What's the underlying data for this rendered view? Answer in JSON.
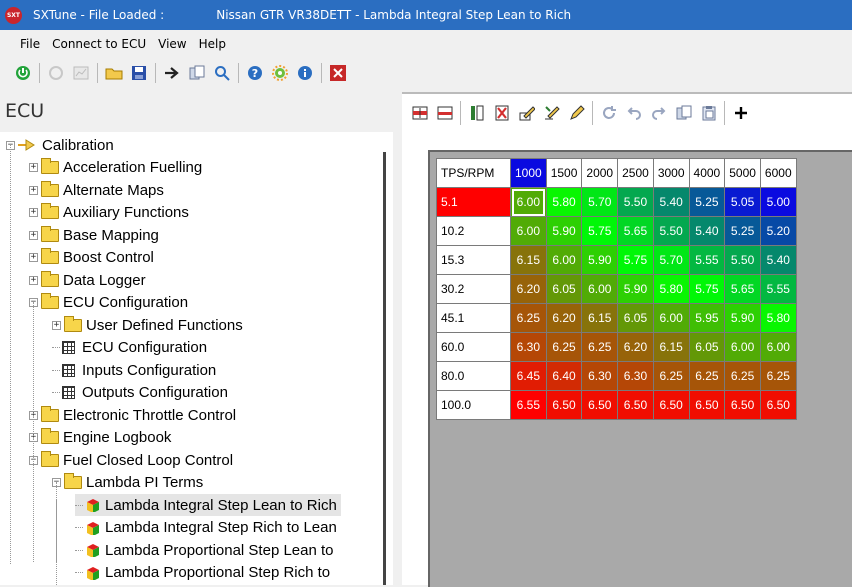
{
  "window": {
    "app_title": "SXTune - File Loaded :",
    "file_title": "Nissan GTR VR38DETT - Lambda Integral Step Lean to Rich",
    "logo_text": "SXT"
  },
  "menu": [
    "File",
    "Connect to ECU",
    "View",
    "Help"
  ],
  "toolbar_icons": [
    "power-icon",
    "disconnect-icon",
    "chart-icon",
    "open-folder-icon",
    "save-icon",
    "send-icon",
    "copy-icon",
    "search-icon",
    "help-icon",
    "settings-icon",
    "info-icon",
    "close-icon"
  ],
  "left_panel": {
    "title": "ECU",
    "tree": [
      {
        "label": "Calibration",
        "level": 0,
        "type": "root",
        "expanded": true
      },
      {
        "label": "Acceleration Fuelling",
        "level": 1,
        "type": "folder",
        "expanded": false
      },
      {
        "label": "Alternate Maps",
        "level": 1,
        "type": "folder",
        "expanded": false
      },
      {
        "label": "Auxiliary Functions",
        "level": 1,
        "type": "folder",
        "expanded": false
      },
      {
        "label": "Base Mapping",
        "level": 1,
        "type": "folder",
        "expanded": false
      },
      {
        "label": "Boost Control",
        "level": 1,
        "type": "folder",
        "expanded": false
      },
      {
        "label": "Data Logger",
        "level": 1,
        "type": "folder",
        "expanded": false
      },
      {
        "label": "ECU Configuration",
        "level": 1,
        "type": "folder",
        "expanded": true
      },
      {
        "label": "User Defined Functions",
        "level": 2,
        "type": "folder",
        "expanded": false
      },
      {
        "label": "ECU Configuration",
        "level": 2,
        "type": "grid"
      },
      {
        "label": "Inputs Configuration",
        "level": 2,
        "type": "grid"
      },
      {
        "label": "Outputs Configuration",
        "level": 2,
        "type": "grid"
      },
      {
        "label": "Electronic Throttle Control",
        "level": 1,
        "type": "folder",
        "expanded": false
      },
      {
        "label": "Engine Logbook",
        "level": 1,
        "type": "folder",
        "expanded": false
      },
      {
        "label": "Fuel Closed Loop Control",
        "level": 1,
        "type": "folder",
        "expanded": true
      },
      {
        "label": "Lambda PI Terms",
        "level": 2,
        "type": "folder",
        "expanded": true
      },
      {
        "label": "Lambda Integral Step Lean to Rich",
        "level": 3,
        "type": "map",
        "selected": true
      },
      {
        "label": "Lambda Integral Step Rich to Lean",
        "level": 3,
        "type": "map"
      },
      {
        "label": "Lambda Proportional Step Lean to",
        "level": 3,
        "type": "map"
      },
      {
        "label": "Lambda Proportional Step Rich to",
        "level": 3,
        "type": "map"
      }
    ]
  },
  "map_toolbar_icons": [
    "insert-row-icon",
    "delete-row-icon",
    "insert-column-icon",
    "delete-column-icon",
    "edit-cells-icon",
    "edit-range-icon",
    "pencil-icon",
    "refresh-icon",
    "undo-icon",
    "redo-icon",
    "copy-icon",
    "paste-icon",
    "plus-icon"
  ],
  "map": {
    "corner_label": "TPS/RPM",
    "columns": [
      "1000",
      "1500",
      "2000",
      "2500",
      "3000",
      "4000",
      "5000",
      "6000"
    ],
    "rows": [
      "5.1",
      "10.2",
      "15.3",
      "30.2",
      "45.1",
      "60.0",
      "80.0",
      "100.0"
    ],
    "values": [
      [
        "6.00",
        "5.80",
        "5.70",
        "5.50",
        "5.40",
        "5.25",
        "5.05",
        "5.00"
      ],
      [
        "6.00",
        "5.90",
        "5.75",
        "5.65",
        "5.50",
        "5.40",
        "5.25",
        "5.20"
      ],
      [
        "6.15",
        "6.00",
        "5.90",
        "5.75",
        "5.70",
        "5.55",
        "5.50",
        "5.40"
      ],
      [
        "6.20",
        "6.05",
        "6.00",
        "5.90",
        "5.80",
        "5.75",
        "5.65",
        "5.55"
      ],
      [
        "6.25",
        "6.20",
        "6.15",
        "6.05",
        "6.00",
        "5.95",
        "5.90",
        "5.80"
      ],
      [
        "6.30",
        "6.25",
        "6.25",
        "6.20",
        "6.15",
        "6.05",
        "6.00",
        "6.00"
      ],
      [
        "6.45",
        "6.40",
        "6.30",
        "6.30",
        "6.25",
        "6.25",
        "6.25",
        "6.25"
      ],
      [
        "6.55",
        "6.50",
        "6.50",
        "6.50",
        "6.50",
        "6.50",
        "6.50",
        "6.50"
      ]
    ],
    "selected_cell": [
      0,
      0
    ],
    "colors": {
      "low": "#0a0ae0",
      "mid": "#00ff00",
      "high": "#ff0000",
      "selected_header_col": "#0a0ae0",
      "selected_header_row": "#ff0000"
    }
  }
}
